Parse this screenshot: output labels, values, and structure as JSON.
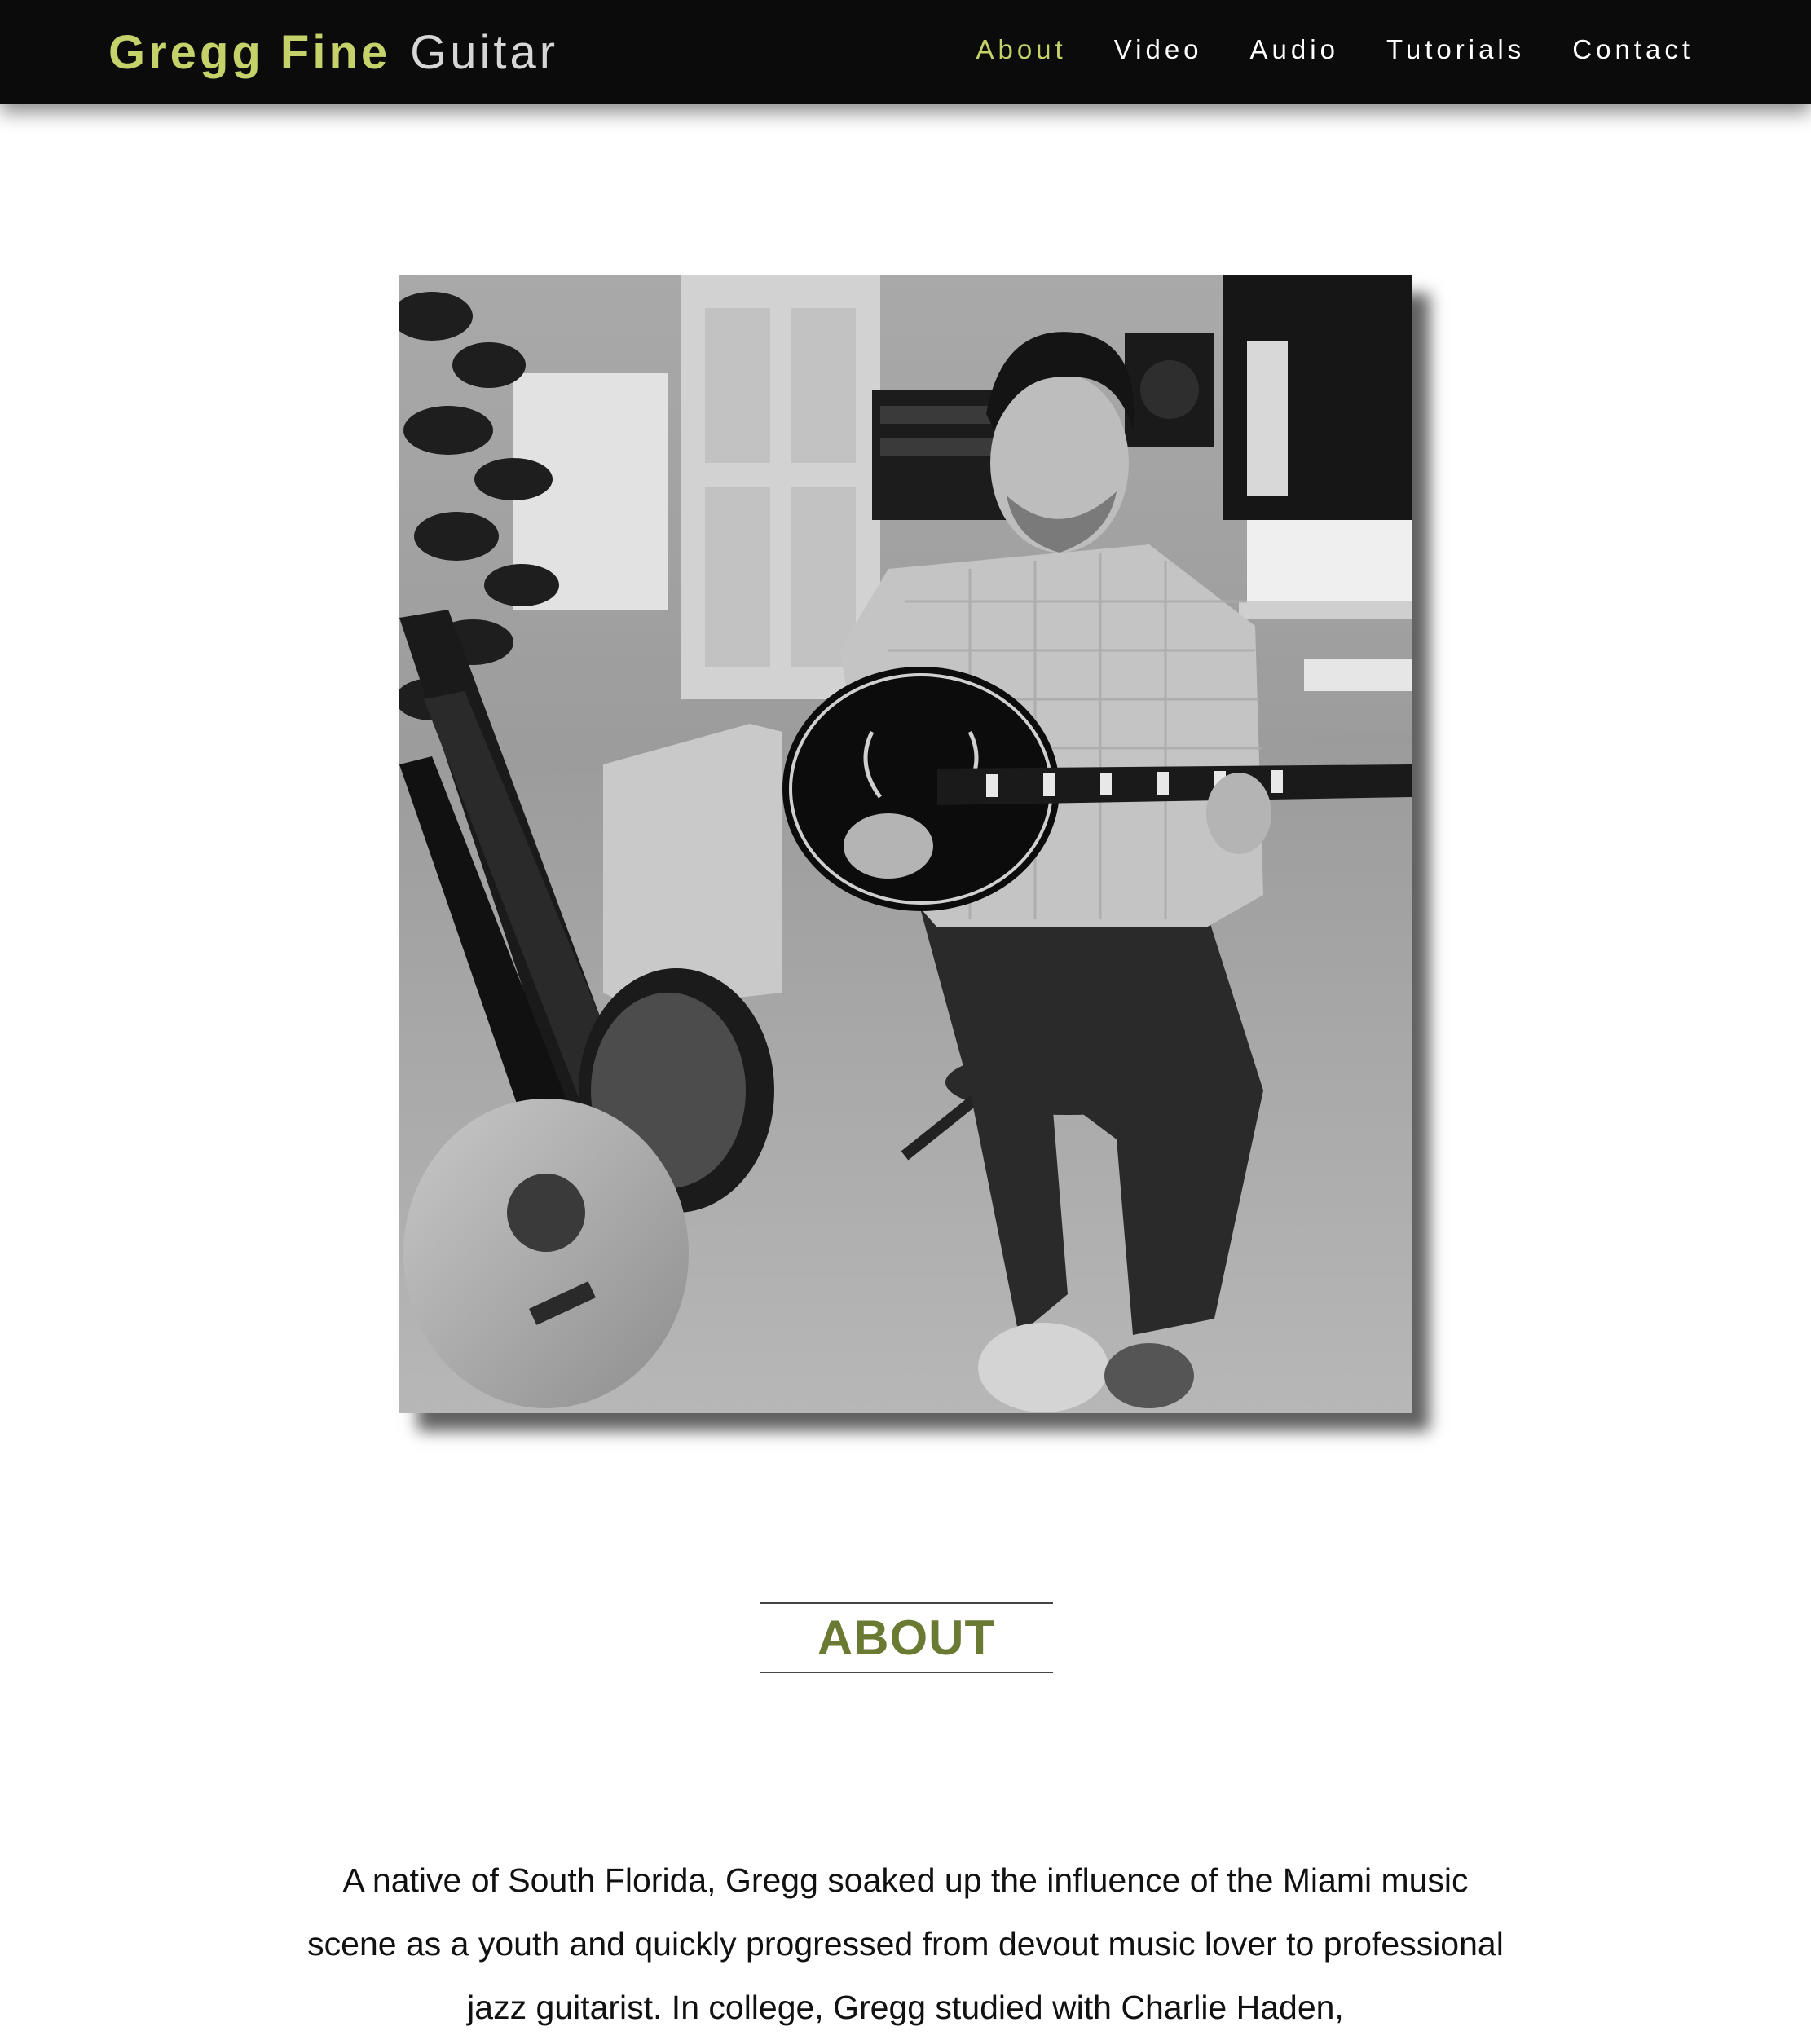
{
  "site": {
    "logo_name": "Gregg Fine",
    "logo_word": "Guitar"
  },
  "nav": {
    "items": [
      {
        "label": "About",
        "active": true
      },
      {
        "label": "Video",
        "active": false
      },
      {
        "label": "Audio",
        "active": false
      },
      {
        "label": "Tutorials",
        "active": false
      },
      {
        "label": "Contact",
        "active": false
      }
    ]
  },
  "about": {
    "heading": "ABOUT",
    "paragraph": "A native of South Florida, Gregg soaked up the influence of the Miami music scene as a youth and quickly progressed from devout music lover to professional jazz guitarist. In college, Gregg studied with Charlie Haden,"
  },
  "colors": {
    "header_bg": "#0b0b0b",
    "accent": "#c5d26a",
    "heading": "#6a7a33"
  },
  "icons": {
    "photo": "black-and-white-portrait-guitarist-in-studio"
  }
}
